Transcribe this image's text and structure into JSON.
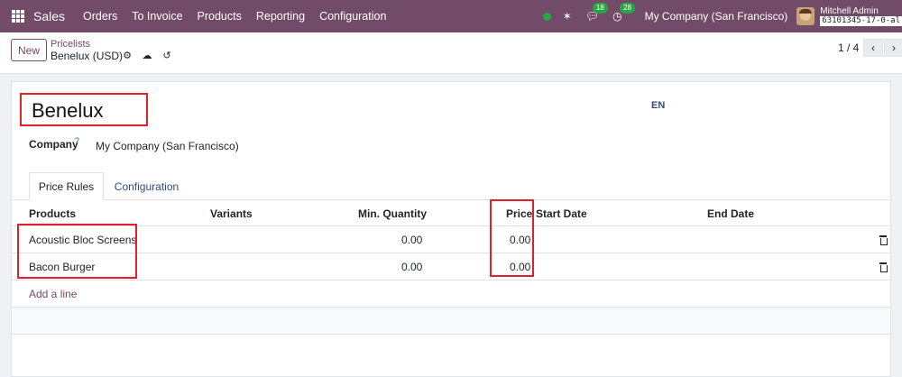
{
  "navbar": {
    "brand": "Sales",
    "menu": [
      "Orders",
      "To Invoice",
      "Products",
      "Reporting",
      "Configuration"
    ],
    "messages_count": "18",
    "activities_count": "28",
    "company": "My Company (San Francisco)",
    "user": "Mitchell Admin",
    "database": "63101345-17-0-al"
  },
  "control_panel": {
    "new_label": "New",
    "breadcrumb": "Pricelists",
    "record_title": "Benelux (USD)",
    "pager": "1 / 4"
  },
  "form": {
    "name": "Benelux",
    "lang": "EN",
    "company_label": "Company",
    "company_help": "?",
    "company_value": "My Company (San Francisco)"
  },
  "tabs": [
    "Price Rules",
    "Configuration"
  ],
  "table": {
    "columns": [
      "Products",
      "Variants",
      "Min. Quantity",
      "Price",
      "Start Date",
      "End Date"
    ],
    "rows": [
      {
        "product": "Acoustic Bloc Screens",
        "variants": "",
        "min_qty": "0.00",
        "price": "0.00",
        "start": "",
        "end": ""
      },
      {
        "product": "Bacon Burger",
        "variants": "",
        "min_qty": "0.00",
        "price": "0.00",
        "start": "",
        "end": ""
      }
    ],
    "add_line": "Add a line"
  },
  "colors": {
    "brand": "#714b67",
    "highlight": "#e0202a",
    "badge": "#28a745"
  }
}
